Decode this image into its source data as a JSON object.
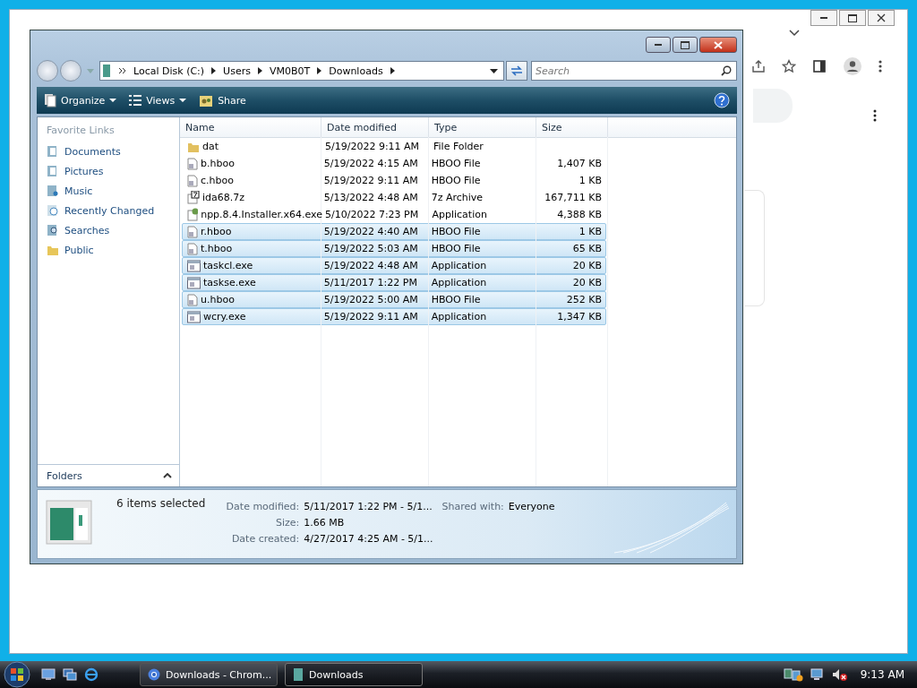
{
  "explorer": {
    "breadcrumb": [
      "Local Disk (C:)",
      "Users",
      "VM0B0T",
      "Downloads"
    ],
    "search": {
      "placeholder": "Search"
    },
    "toolbar": [
      {
        "label": "Organize",
        "kind": "organize",
        "dropdown": true
      },
      {
        "label": "Views",
        "kind": "views",
        "dropdown": true
      },
      {
        "label": "Share",
        "kind": "share",
        "dropdown": false
      }
    ],
    "favorite_links": {
      "title": "Favorite Links",
      "items": [
        {
          "label": "Documents",
          "kind": "documents"
        },
        {
          "label": "Pictures",
          "kind": "pictures"
        },
        {
          "label": "Music",
          "kind": "music"
        },
        {
          "label": "Recently Changed",
          "kind": "recent"
        },
        {
          "label": "Searches",
          "kind": "searches"
        },
        {
          "label": "Public",
          "kind": "folder"
        }
      ]
    },
    "folders_label": "Folders",
    "columns": [
      "Name",
      "Date modified",
      "Type",
      "Size"
    ],
    "files": [
      {
        "name": "dat",
        "date": "5/19/2022 9:11 AM",
        "type": "File Folder",
        "kind": "folder",
        "selected": false
      },
      {
        "name": "b.hboo",
        "date": "5/19/2022 4:15 AM",
        "type": "HBOO File",
        "size": "1,407 KB",
        "kind": "file",
        "selected": false
      },
      {
        "name": "c.hboo",
        "date": "5/19/2022 9:11 AM",
        "type": "HBOO File",
        "size": "1 KB",
        "kind": "file",
        "selected": false
      },
      {
        "name": "ida68.7z",
        "date": "5/13/2022 4:48 AM",
        "type": "7z Archive",
        "size": "167,711 KB",
        "kind": "archive",
        "selected": false
      },
      {
        "name": "npp.8.4.Installer.x64.exe",
        "date": "5/10/2022 7:23 PM",
        "type": "Application",
        "size": "4,388 KB",
        "kind": "installer",
        "selected": false
      },
      {
        "name": "r.hboo",
        "date": "5/19/2022 4:40 AM",
        "type": "HBOO File",
        "size": "1 KB",
        "kind": "file",
        "selected": true
      },
      {
        "name": "t.hboo",
        "date": "5/19/2022 5:03 AM",
        "type": "HBOO File",
        "size": "65 KB",
        "kind": "file",
        "selected": true
      },
      {
        "name": "taskcl.exe",
        "date": "5/19/2022 4:48 AM",
        "type": "Application",
        "size": "20 KB",
        "kind": "app",
        "selected": true
      },
      {
        "name": "taskse.exe",
        "date": "5/11/2017 1:22 PM",
        "type": "Application",
        "size": "20 KB",
        "kind": "app",
        "selected": true
      },
      {
        "name": "u.hboo",
        "date": "5/19/2022 5:00 AM",
        "type": "HBOO File",
        "size": "252 KB",
        "kind": "file",
        "selected": true
      },
      {
        "name": "wcry.exe",
        "date": "5/19/2022 9:11 AM",
        "type": "Application",
        "size": "1,347 KB",
        "kind": "app",
        "selected": true
      }
    ],
    "details": {
      "summary": "6 items selected",
      "fields": [
        {
          "label": "Date modified:",
          "value": "5/11/2017 1:22 PM - 5/1..."
        },
        {
          "label": "Size:",
          "value": "1.66 MB"
        },
        {
          "label": "Date created:",
          "value": "4/27/2017 4:25 AM - 5/1..."
        }
      ],
      "shared_label": "Shared with:",
      "shared_value": "Everyone"
    }
  },
  "taskbar": {
    "tasks": [
      {
        "label": "Downloads - Chrom...",
        "kind": "chrome",
        "selected": false
      },
      {
        "label": "Downloads",
        "kind": "explorer",
        "selected": true
      }
    ],
    "clock": "9:13 AM"
  }
}
